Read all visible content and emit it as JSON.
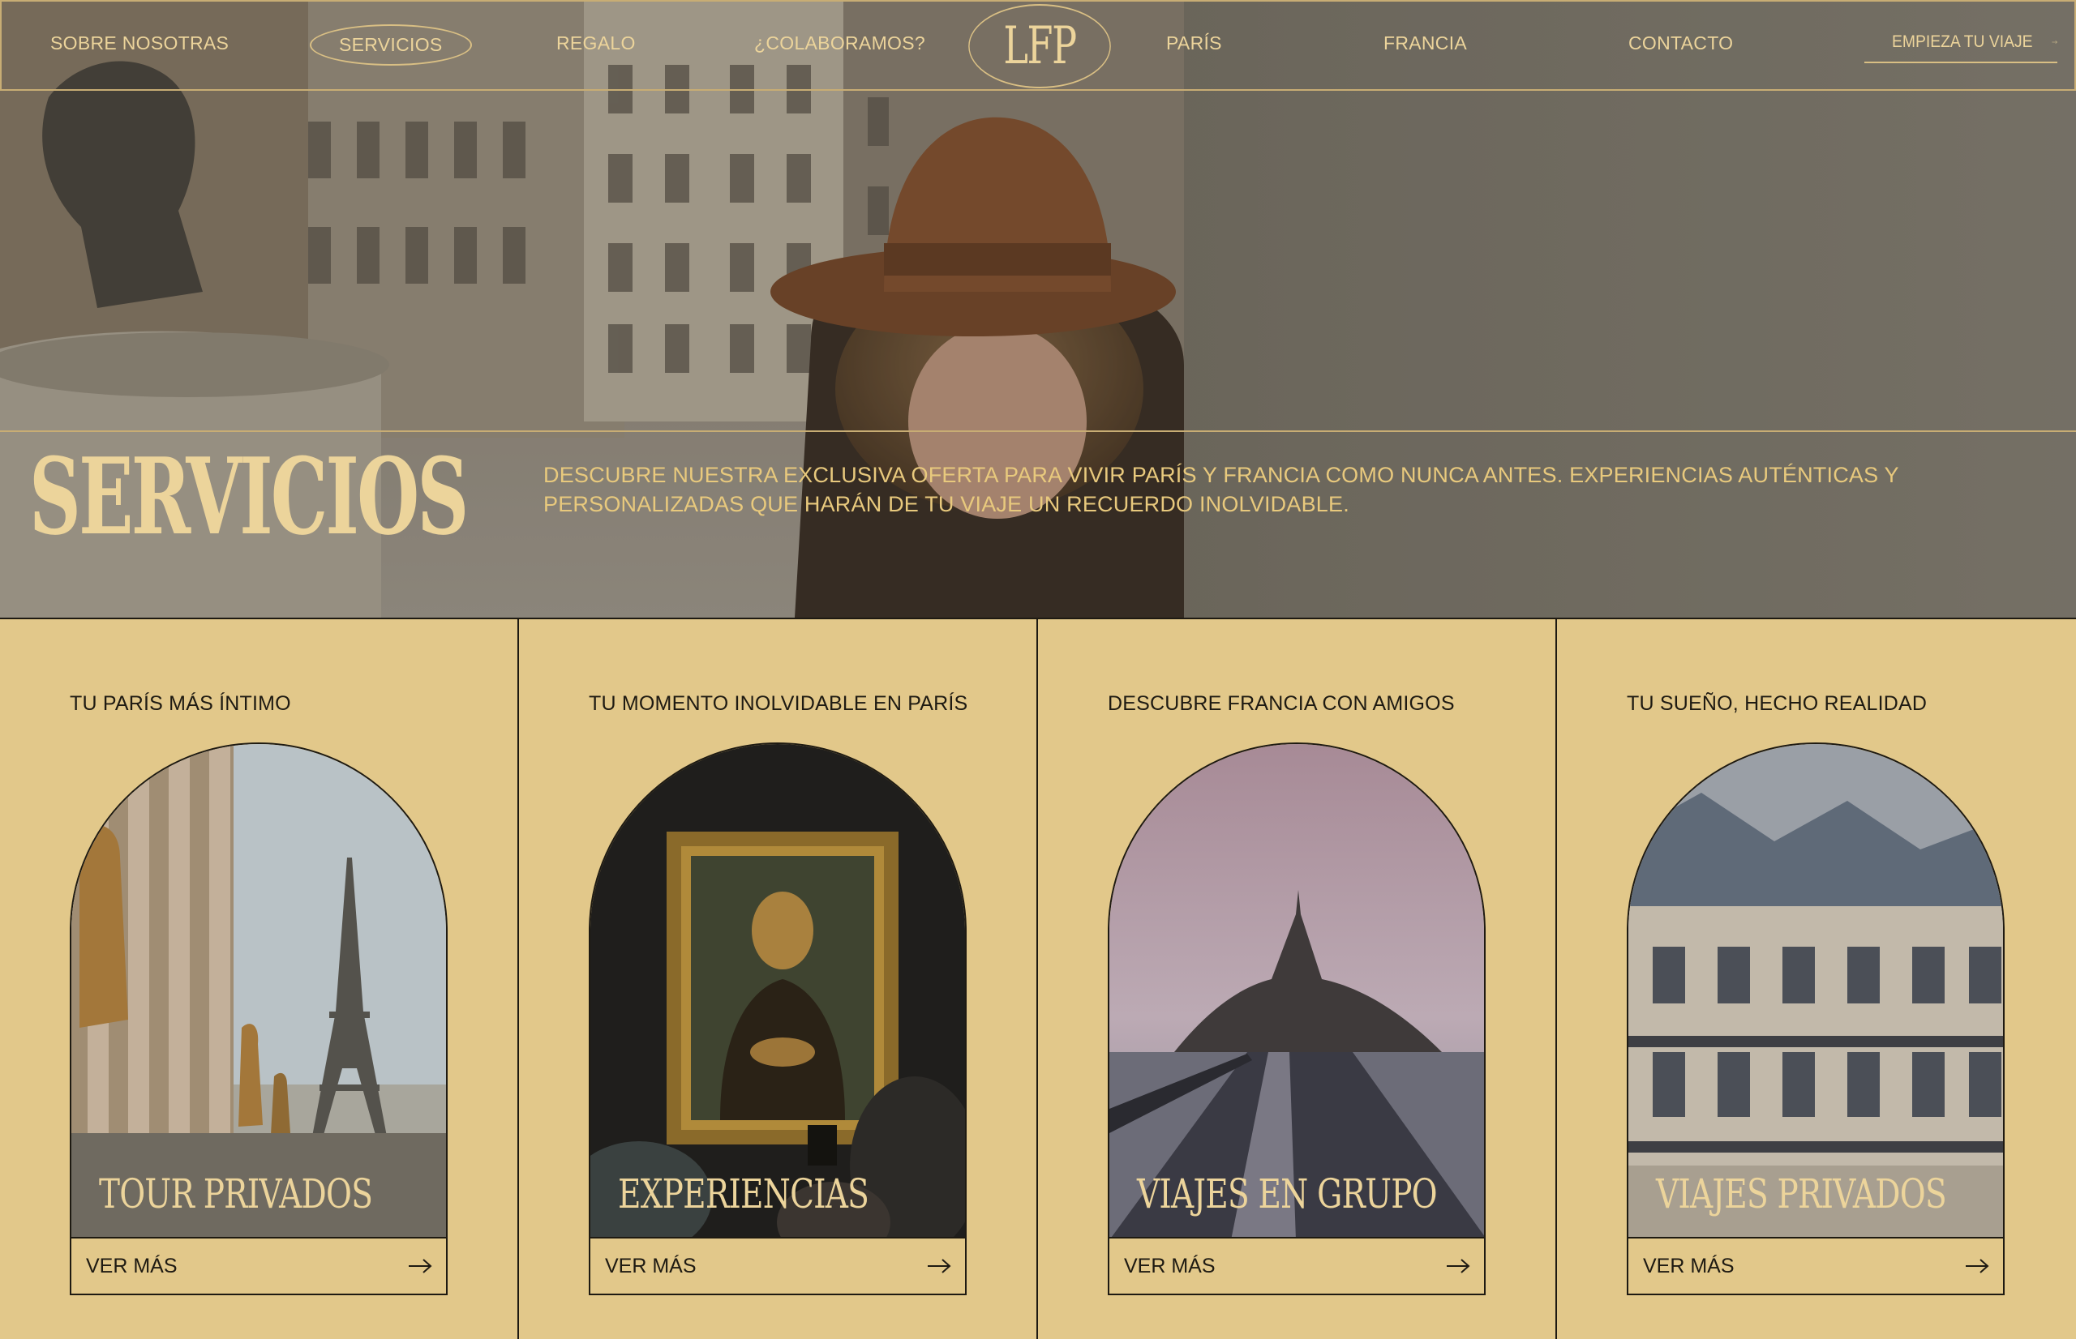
{
  "nav": {
    "items": [
      {
        "label": "SOBRE NOSOTRAS"
      },
      {
        "label": "SERVICIOS",
        "active": true
      },
      {
        "label": "REGALO"
      },
      {
        "label": "¿COLABORAMOS?"
      },
      {
        "label": "PARÍS"
      },
      {
        "label": "FRANCIA"
      },
      {
        "label": "CONTACTO"
      }
    ],
    "logo": "LFP",
    "cta": "EMPIEZA TU VIAJE",
    "cta_icon": "arrow-right-icon"
  },
  "hero": {
    "title": "SERVICIOS",
    "description": "DESCUBRE NUESTRA EXCLUSIVA OFERTA PARA VIVIR PARÍS Y FRANCIA COMO NUNCA ANTES. EXPERIENCIAS AUTÉNTICAS Y PERSONALIZADAS QUE HARÁN DE TU VIAJE UN RECUERDO INOLVIDABLE."
  },
  "cards": [
    {
      "tagline": "TU PARÍS MÁS ÍNTIMO",
      "title": "TOUR PRIVADOS",
      "cta": "VER MÁS",
      "image": "eiffel-tower-photo"
    },
    {
      "tagline": "TU MOMENTO INOLVIDABLE EN PARÍS",
      "title": "EXPERIENCIAS",
      "cta": "VER MÁS",
      "image": "mona-lisa-photo"
    },
    {
      "tagline": "DESCUBRE FRANCIA CON AMIGOS",
      "title": "VIAJES EN GRUPO",
      "cta": "VER MÁS",
      "image": "mont-saint-michel-photo"
    },
    {
      "tagline": "TU SUEÑO, HECHO REALIDAD",
      "title": "VIAJES PRIVADOS",
      "cta": "VER MÁS",
      "image": "paris-building-photo"
    }
  ],
  "colors": {
    "gold": "#ecd49b",
    "card_bg": "#e2c88a",
    "ink": "#1e1a12"
  }
}
